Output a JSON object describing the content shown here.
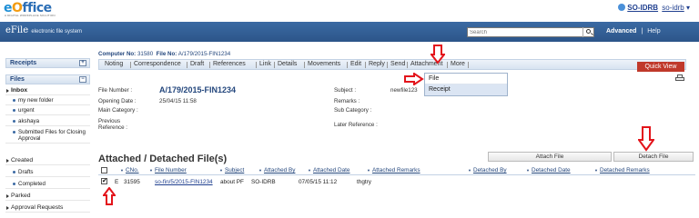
{
  "brand": {
    "logo_e": "e",
    "logo_o": "O",
    "logo_rest": "ffice",
    "logo_sub": "A DIGITAL WORKPLACE SOLUTION"
  },
  "user": {
    "name": "SO-IDRB",
    "sub": "so-idrb"
  },
  "header": {
    "title": "eFile",
    "subtitle": "electronic file system",
    "search_placeholder": "Search",
    "advanced": "Advanced",
    "separator": "|",
    "help": "Help"
  },
  "sidebar": {
    "receipts": "Receipts",
    "files": "Files",
    "toggle_plus": "+",
    "toggle_minus": "−",
    "inbox": "Inbox",
    "inbox_items": [
      "my new folder",
      "urgent",
      "akshaya",
      "Submitted Files for Closing Approval"
    ],
    "created": "Created",
    "created_items": [
      "Drafts",
      "Completed"
    ],
    "parked": "Parked",
    "approval": "Approval Requests"
  },
  "file_header": {
    "computer_no_label": "Computer No:",
    "computer_no": "31580",
    "file_no_label": "File No:",
    "file_no": "A/179/2015-FIN1234"
  },
  "menu": {
    "items": [
      "Noting",
      "Correspondence",
      "Draft",
      "References",
      "Link",
      "Details",
      "Movements",
      "Edit",
      "Reply",
      "Send",
      "Attachment",
      "More"
    ],
    "quick_view": "Quick View"
  },
  "dropdown": {
    "items": [
      "File",
      "Receipt"
    ]
  },
  "file_info": {
    "file_number_label": "File Number :",
    "file_number": "A/179/2015-FIN1234",
    "opening_date_label": "Opening Date :",
    "opening_date": "25/04/15 11:58",
    "main_category_label": "Main Category :",
    "previous_reference_label": "Previous Reference :",
    "subject_label": "Subject :",
    "subject": "newfile123",
    "remarks_label": "Remarks :",
    "sub_category_label": "Sub Category :",
    "later_reference_label": "Later Reference :"
  },
  "attached": {
    "title": "Attached / Detached File(s)",
    "attach_btn": "Attach File",
    "detach_btn": "Detach File",
    "columns": [
      "CNo.",
      "File Number",
      "Subject",
      "Attached By",
      "Attached Date",
      "Attached Remarks",
      "Detached By",
      "Detached Date",
      "Detached Remarks"
    ],
    "rows": [
      {
        "type": "E",
        "cno": "31595",
        "file_number": "so-fin/5/2015-FIN1234",
        "subject": "about PF",
        "attached_by": "SO-IDRB",
        "attached_date": "07/05/15 11:12",
        "attached_remarks": "thgtry"
      }
    ]
  },
  "colors": {
    "header_blue": "#2c5589",
    "link_blue": "#1f3f8f",
    "quick_view_red": "#c0392b",
    "arrow_red": "#e3141b"
  },
  "icons": [
    "search-icon",
    "print-icon",
    "user-icon",
    "arrow-down-icon",
    "arrow-right-icon",
    "arrow-up-icon"
  ]
}
